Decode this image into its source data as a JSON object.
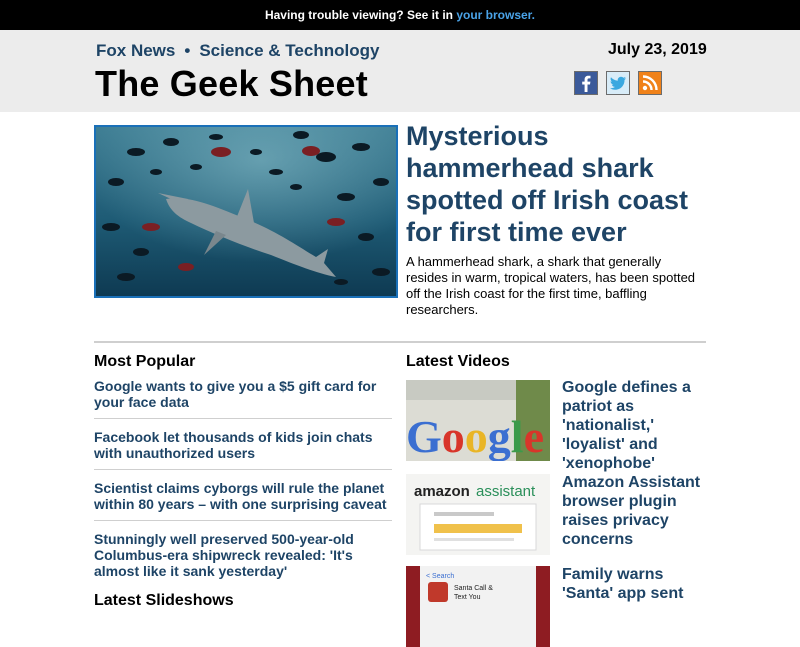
{
  "topbar": {
    "text": "Having trouble viewing? See it in",
    "link": "your browser."
  },
  "header": {
    "crumb_1": "Fox News",
    "separator": "•",
    "crumb_2": "Science & Technology",
    "title": "The Geek Sheet",
    "date": "July 23, 2019"
  },
  "social": {
    "icons": [
      "facebook-icon",
      "twitter-icon",
      "rss-icon"
    ]
  },
  "hero": {
    "title": "Mysterious hammerhead shark spotted off Irish coast for first time ever",
    "description": "A hammerhead shark, a shark that generally resides in warm, tropical waters, has been spotted off the Irish coast for the first time, baffling researchers."
  },
  "most_popular": {
    "heading": "Most Popular",
    "items": [
      "Google wants to give you a $5 gift card for your face data",
      "Facebook let thousands of kids join chats with unauthorized users",
      "Scientist claims cyborgs will rule the planet within 80 years – with one surprising caveat",
      "Stunningly well preserved 500-year-old Columbus-era shipwreck revealed: 'It's almost like it sank yesterday'"
    ],
    "next_heading": "Latest Slideshows"
  },
  "latest_videos": {
    "heading": "Latest Videos",
    "items": [
      {
        "title": "Google defines a patriot as 'nationalist,' 'loyalist' and 'xenophobe'",
        "thumb_text": "Google"
      },
      {
        "title": "Amazon Assistant browser plugin raises privacy concerns",
        "thumb_text": "amazon assistant"
      },
      {
        "title": "Family warns 'Santa' app sent",
        "thumb_text": "Santa Call & Text You"
      }
    ]
  },
  "colors": {
    "link": "#1e4466",
    "topbar": "#000000",
    "header_bg": "#ececec",
    "accent_link": "#4aa3e8"
  }
}
